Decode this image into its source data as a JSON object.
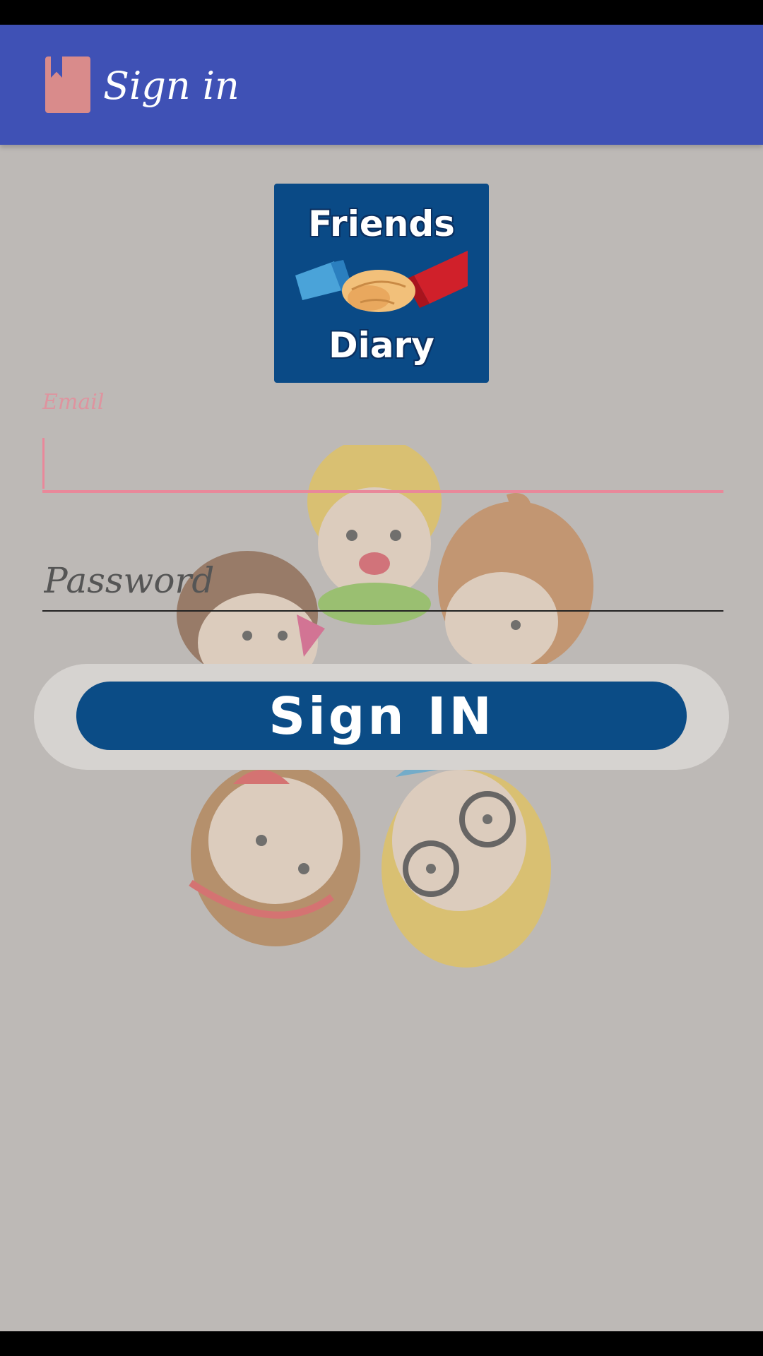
{
  "app_bar": {
    "title": "Sign in",
    "background": "#3f51b5",
    "icon": "bookmark-icon"
  },
  "logo": {
    "line1": "Friends",
    "line2": "Diary",
    "icon": "handshake-icon",
    "background": "#0a4a86"
  },
  "illustration": {
    "icon": "kids-circle-illustration"
  },
  "form": {
    "email": {
      "label": "Email",
      "value": "",
      "accent": "#e9889a"
    },
    "password": {
      "placeholder": "Password",
      "value": ""
    },
    "sign_in_label": "Sign IN"
  },
  "colors": {
    "background": "#bdb9b6",
    "button": "#0b4c86"
  }
}
